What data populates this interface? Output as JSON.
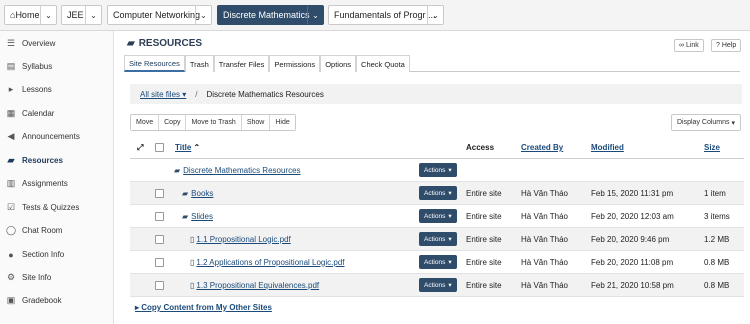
{
  "topnav": {
    "home": "Home",
    "sites": [
      {
        "label": "JEE"
      },
      {
        "label": "Computer Networking"
      },
      {
        "label": "Discrete Mathematics"
      },
      {
        "label": "Fundamentals of Progr ..."
      }
    ]
  },
  "sidebar": {
    "items": [
      {
        "label": "Overview",
        "icon": "overview-icon"
      },
      {
        "label": "Syllabus",
        "icon": "syllabus-icon"
      },
      {
        "label": "Lessons",
        "icon": "lessons-icon"
      },
      {
        "label": "Calendar",
        "icon": "calendar-icon"
      },
      {
        "label": "Announcements",
        "icon": "megaphone-icon"
      },
      {
        "label": "Resources",
        "icon": "folder-open-icon"
      },
      {
        "label": "Assignments",
        "icon": "assignments-icon"
      },
      {
        "label": "Tests & Quizzes",
        "icon": "checkbox-icon"
      },
      {
        "label": "Chat Room",
        "icon": "chat-icon"
      },
      {
        "label": "Section Info",
        "icon": "user-icon"
      },
      {
        "label": "Site Info",
        "icon": "gear-icon"
      },
      {
        "label": "Gradebook",
        "icon": "gradebook-icon"
      }
    ]
  },
  "main": {
    "title": "RESOURCES",
    "link_label": "Link",
    "help_label": "Help",
    "tabs": [
      {
        "label": "Site Resources"
      },
      {
        "label": "Trash"
      },
      {
        "label": "Transfer Files"
      },
      {
        "label": "Permissions"
      },
      {
        "label": "Options"
      },
      {
        "label": "Check Quota"
      }
    ],
    "breadcrumb": {
      "root": "All site files",
      "current": "Discrete Mathematics Resources"
    },
    "action_buttons": {
      "move": "Move",
      "copy": "Copy",
      "trash": "Move to Trash",
      "show": "Show",
      "hide": "Hide"
    },
    "display_columns": "Display Columns",
    "table": {
      "headers": {
        "title": "Title",
        "access": "Access",
        "created_by": "Created By",
        "modified": "Modified",
        "size": "Size"
      },
      "actions_label": "Actions",
      "root_row": {
        "title": "Discrete Mathematics Resources"
      },
      "rows": [
        {
          "title": "Books",
          "type": "folder",
          "access": "Entire site",
          "created_by": "Hà Văn Tháo",
          "modified": "Feb 15, 2020 11:31 pm",
          "size": "1 item"
        },
        {
          "title": "Slides",
          "type": "folder",
          "access": "Entire site",
          "created_by": "Hà Văn Tháo",
          "modified": "Feb 20, 2020 12:03 am",
          "size": "3 items"
        },
        {
          "title": "1.1 Propositional Logic.pdf",
          "type": "file",
          "access": "Entire site",
          "created_by": "Hà Văn Tháo",
          "modified": "Feb 20, 2020 9:46 pm",
          "size": "1.2 MB"
        },
        {
          "title": "1.2 Applications of Propositional Logic.pdf",
          "type": "file",
          "access": "Entire site",
          "created_by": "Hà Văn Tháo",
          "modified": "Feb 20, 2020 11:08 pm",
          "size": "0.8 MB"
        },
        {
          "title": "1.3 Propositional Equivalences.pdf",
          "type": "file",
          "access": "Entire site",
          "created_by": "Hà Văn Tháo",
          "modified": "Feb 21, 2020 10:58 pm",
          "size": "0.8 MB"
        }
      ]
    },
    "copy_content": "Copy Content from My Other Sites"
  }
}
